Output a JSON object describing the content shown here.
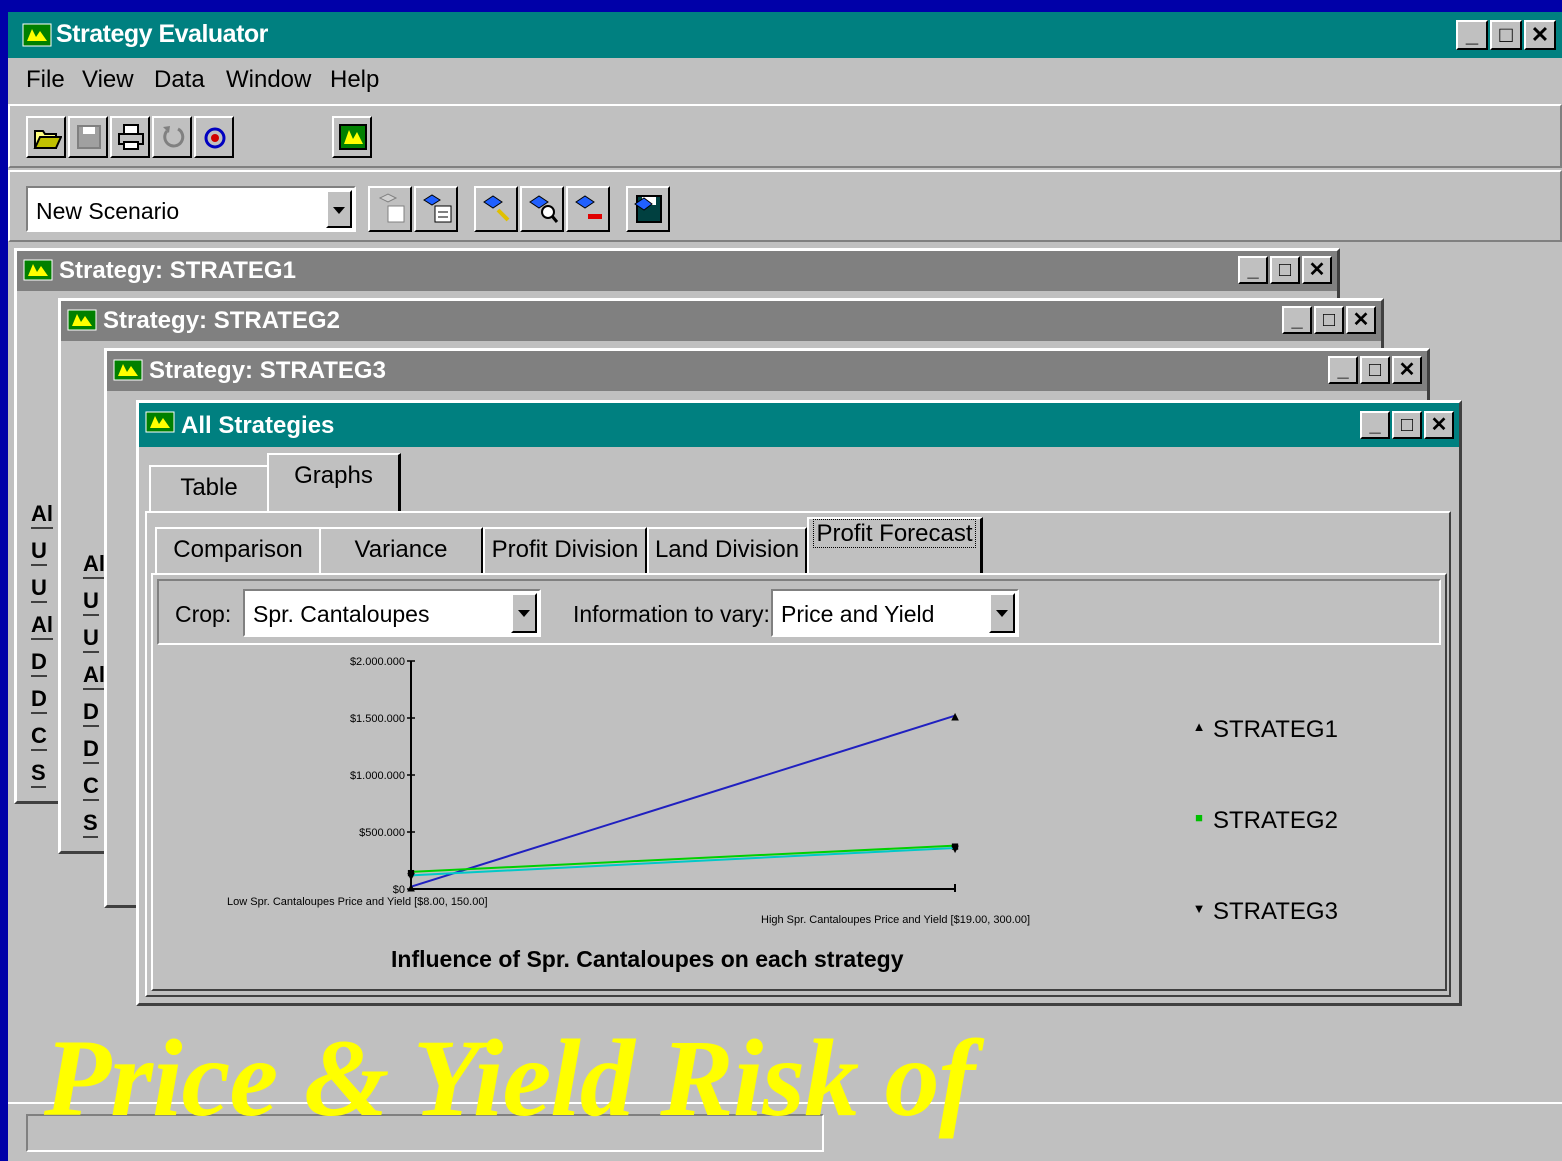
{
  "app": {
    "title": "Strategy Evaluator",
    "menu": [
      "File",
      "View",
      "Data",
      "Window",
      "Help"
    ],
    "scenario_select": "New Scenario"
  },
  "windows": {
    "w1": "Strategy: STRATEG1",
    "w2": "Strategy: STRATEG2",
    "w3": "Strategy: STRATEG3",
    "w4": "All Strategies"
  },
  "tabs_main": [
    "Table",
    "Graphs"
  ],
  "tabs_graph": [
    "Comparison",
    "Variance",
    "Profit Division",
    "Land Division",
    "Profit Forecast"
  ],
  "controls": {
    "crop_label": "Crop:",
    "crop_value": "Spr. Cantaloupes",
    "vary_label": "Information to vary:",
    "vary_value": "Price and Yield"
  },
  "partial_rows": {
    "w1": [
      "Al",
      "U",
      "U",
      "Al",
      "D",
      "D",
      "C",
      "S"
    ],
    "w2": [
      "Al",
      "U",
      "U",
      "Al",
      "D",
      "D",
      "C",
      "S"
    ]
  },
  "overlay_text": "Price & Yield Risk of",
  "chart_data": {
    "type": "line",
    "title": "Influence of Spr. Cantaloupes on each strategy",
    "x": [
      "Low Spr. Cantaloupes Price and Yield [$8.00, 150.00]",
      "High Spr. Cantaloupes Price and Yield [$19.00, 300.00]"
    ],
    "y_ticks": [
      "$0",
      "$500.000",
      "$1.000.000",
      "$1.500.000",
      "$2.000.000"
    ],
    "ylim": [
      0,
      2000000
    ],
    "series": [
      {
        "name": "STRATEG1",
        "values": [
          20000,
          1520000
        ],
        "color": "#2020c0",
        "marker": "▲"
      },
      {
        "name": "STRATEG2",
        "values": [
          150000,
          380000
        ],
        "color": "#00d000",
        "marker": "■"
      },
      {
        "name": "STRATEG3",
        "values": [
          120000,
          360000
        ],
        "color": "#00c8c8",
        "marker": "▼"
      }
    ],
    "legend": "right"
  }
}
